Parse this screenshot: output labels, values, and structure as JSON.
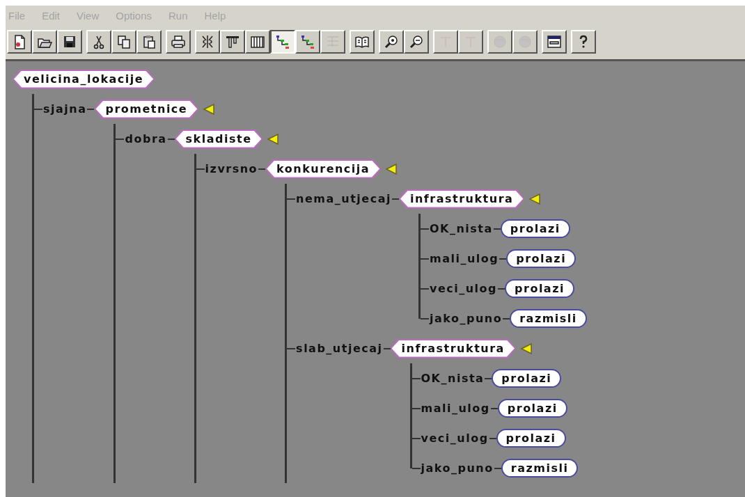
{
  "menu": [
    "File",
    "Edit",
    "View",
    "Options",
    "Run",
    "Help"
  ],
  "toolbar": [
    [
      {
        "kind": "new",
        "pressed": false,
        "disabled": false
      },
      {
        "kind": "open",
        "pressed": false,
        "disabled": false
      },
      {
        "kind": "save",
        "pressed": false,
        "disabled": false
      }
    ],
    [
      {
        "kind": "cut",
        "pressed": false,
        "disabled": false
      },
      {
        "kind": "copy",
        "pressed": false,
        "disabled": false
      },
      {
        "kind": "paste",
        "pressed": false,
        "disabled": false
      }
    ],
    [
      {
        "kind": "print",
        "pressed": false,
        "disabled": false
      }
    ],
    [
      {
        "kind": "split",
        "pressed": false,
        "disabled": false
      },
      {
        "kind": "bars",
        "pressed": false,
        "disabled": false
      },
      {
        "kind": "columns",
        "pressed": false,
        "disabled": false
      },
      {
        "kind": "tree",
        "pressed": true,
        "disabled": false
      },
      {
        "kind": "tree",
        "pressed": false,
        "disabled": false
      },
      {
        "kind": "grid",
        "pressed": false,
        "disabled": true
      }
    ],
    [
      {
        "kind": "book",
        "pressed": false,
        "disabled": false
      }
    ],
    [
      {
        "kind": "zoom_in",
        "pressed": false,
        "disabled": false
      },
      {
        "kind": "zoom_out",
        "pressed": false,
        "disabled": false
      }
    ],
    [
      {
        "kind": "tee",
        "pressed": false,
        "disabled": true
      },
      {
        "kind": "tee",
        "pressed": false,
        "disabled": true
      }
    ],
    [
      {
        "kind": "globe",
        "pressed": false,
        "disabled": true
      },
      {
        "kind": "globe",
        "pressed": false,
        "disabled": true
      }
    ],
    [
      {
        "kind": "window",
        "pressed": false,
        "disabled": false
      }
    ],
    [
      {
        "kind": "help",
        "pressed": false,
        "disabled": false
      }
    ]
  ],
  "tree": {
    "label": "velicina_lokacije",
    "kind": "decision",
    "marker": false,
    "children": [
      {
        "branch": "sjajna",
        "last": false,
        "label": "prometnice",
        "kind": "decision",
        "marker": true,
        "children": [
          {
            "branch": "dobra",
            "last": false,
            "label": "skladiste",
            "kind": "decision",
            "marker": true,
            "children": [
              {
                "branch": "izvrsno",
                "last": false,
                "label": "konkurencija",
                "kind": "decision",
                "marker": true,
                "children": [
                  {
                    "branch": "nema_utjecaj",
                    "last": false,
                    "label": "infrastruktura",
                    "kind": "decision",
                    "marker": true,
                    "children": [
                      {
                        "branch": "OK_nista",
                        "last": false,
                        "label": "prolazi",
                        "kind": "leaf"
                      },
                      {
                        "branch": "mali_ulog",
                        "last": false,
                        "label": "prolazi",
                        "kind": "leaf"
                      },
                      {
                        "branch": "veci_ulog",
                        "last": false,
                        "label": "prolazi",
                        "kind": "leaf"
                      },
                      {
                        "branch": "jako_puno",
                        "last": true,
                        "label": "razmisli",
                        "kind": "leaf"
                      }
                    ]
                  },
                  {
                    "branch": "slab_utjecaj",
                    "last": false,
                    "label": "infrastruktura",
                    "kind": "decision",
                    "marker": true,
                    "children": [
                      {
                        "branch": "OK_nista",
                        "last": false,
                        "label": "prolazi",
                        "kind": "leaf"
                      },
                      {
                        "branch": "mali_ulog",
                        "last": false,
                        "label": "prolazi",
                        "kind": "leaf"
                      },
                      {
                        "branch": "veci_ulog",
                        "last": false,
                        "label": "prolazi",
                        "kind": "leaf"
                      },
                      {
                        "branch": "jako_puno",
                        "last": true,
                        "label": "razmisli",
                        "kind": "leaf"
                      }
                    ]
                  }
                ]
              }
            ]
          }
        ]
      }
    ]
  }
}
